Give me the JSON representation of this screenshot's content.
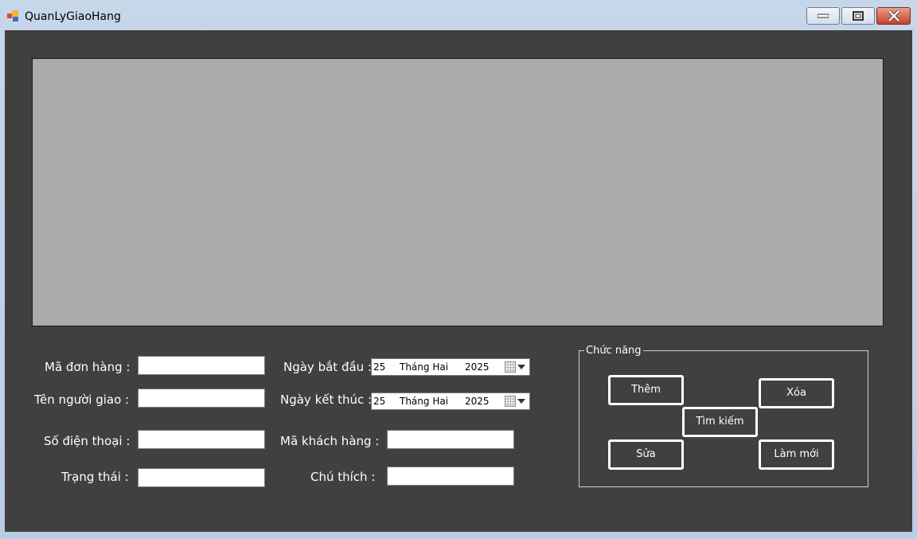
{
  "window": {
    "title": "QuanLyGiaoHang",
    "controls": [
      "minimize-icon",
      "maximize-icon",
      "close-icon"
    ]
  },
  "colors": {
    "client_bg": "#404040",
    "grid_bg": "#ababab",
    "titlebar_bg": "#c7d7ea",
    "close_btn": "#c6402a"
  },
  "form": {
    "ma_don_hang": {
      "label": "Mã đơn hàng :",
      "value": ""
    },
    "ten_nguoi_giao": {
      "label": "Tên người giao :",
      "value": ""
    },
    "so_dien_thoai": {
      "label": "Số điện thoại :",
      "value": ""
    },
    "trang_thai": {
      "label": "Trạng thái :",
      "value": ""
    },
    "ngay_bat_dau": {
      "label": "Ngày bắt đầu :",
      "day": "25",
      "month": "Tháng Hai",
      "year": "2025"
    },
    "ngay_ket_thuc": {
      "label": "Ngày kết thúc :",
      "day": "25",
      "month": "Tháng Hai",
      "year": "2025"
    },
    "ma_khach_hang": {
      "label": "Mã khách hàng :",
      "value": ""
    },
    "chu_thich": {
      "label": "Chú thích :",
      "value": ""
    }
  },
  "functions": {
    "title": "Chức năng",
    "them": "Thêm",
    "xoa": "Xóa",
    "tim_kiem": "Tìm kiếm",
    "sua": "Sửa",
    "lam_moi": "Làm mới"
  }
}
